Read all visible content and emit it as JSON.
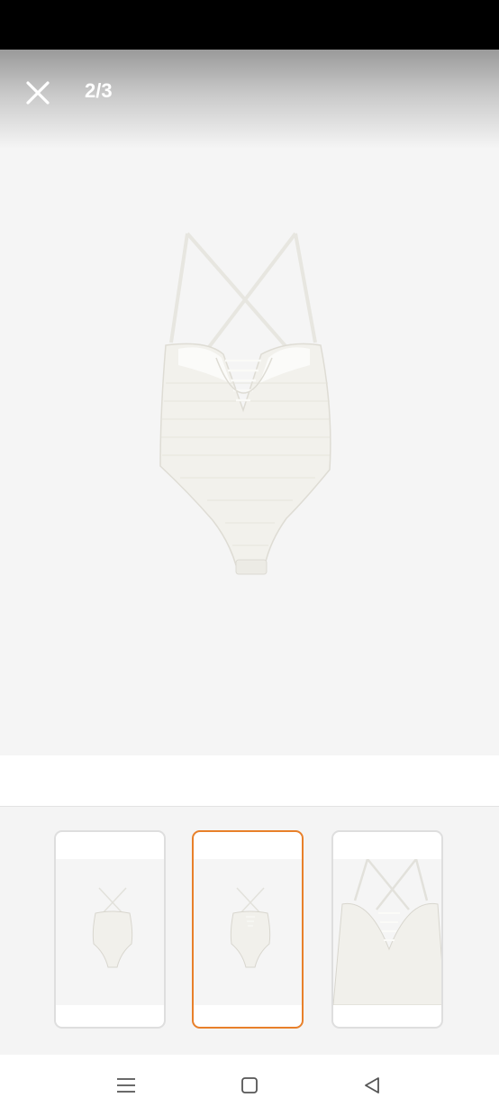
{
  "viewer": {
    "counter": "2/3",
    "current_index": 2,
    "total_images": 3
  },
  "icons": {
    "close": "close-icon",
    "menu": "menu-icon",
    "home": "home-square-icon",
    "back": "back-triangle-icon"
  },
  "thumbnails": [
    {
      "view": "front",
      "selected": false
    },
    {
      "view": "back",
      "selected": true
    },
    {
      "view": "detail",
      "selected": false
    }
  ],
  "colors": {
    "accent": "#e8802a",
    "background": "#f5f5f5",
    "swimsuit": "#f2f1ec"
  }
}
